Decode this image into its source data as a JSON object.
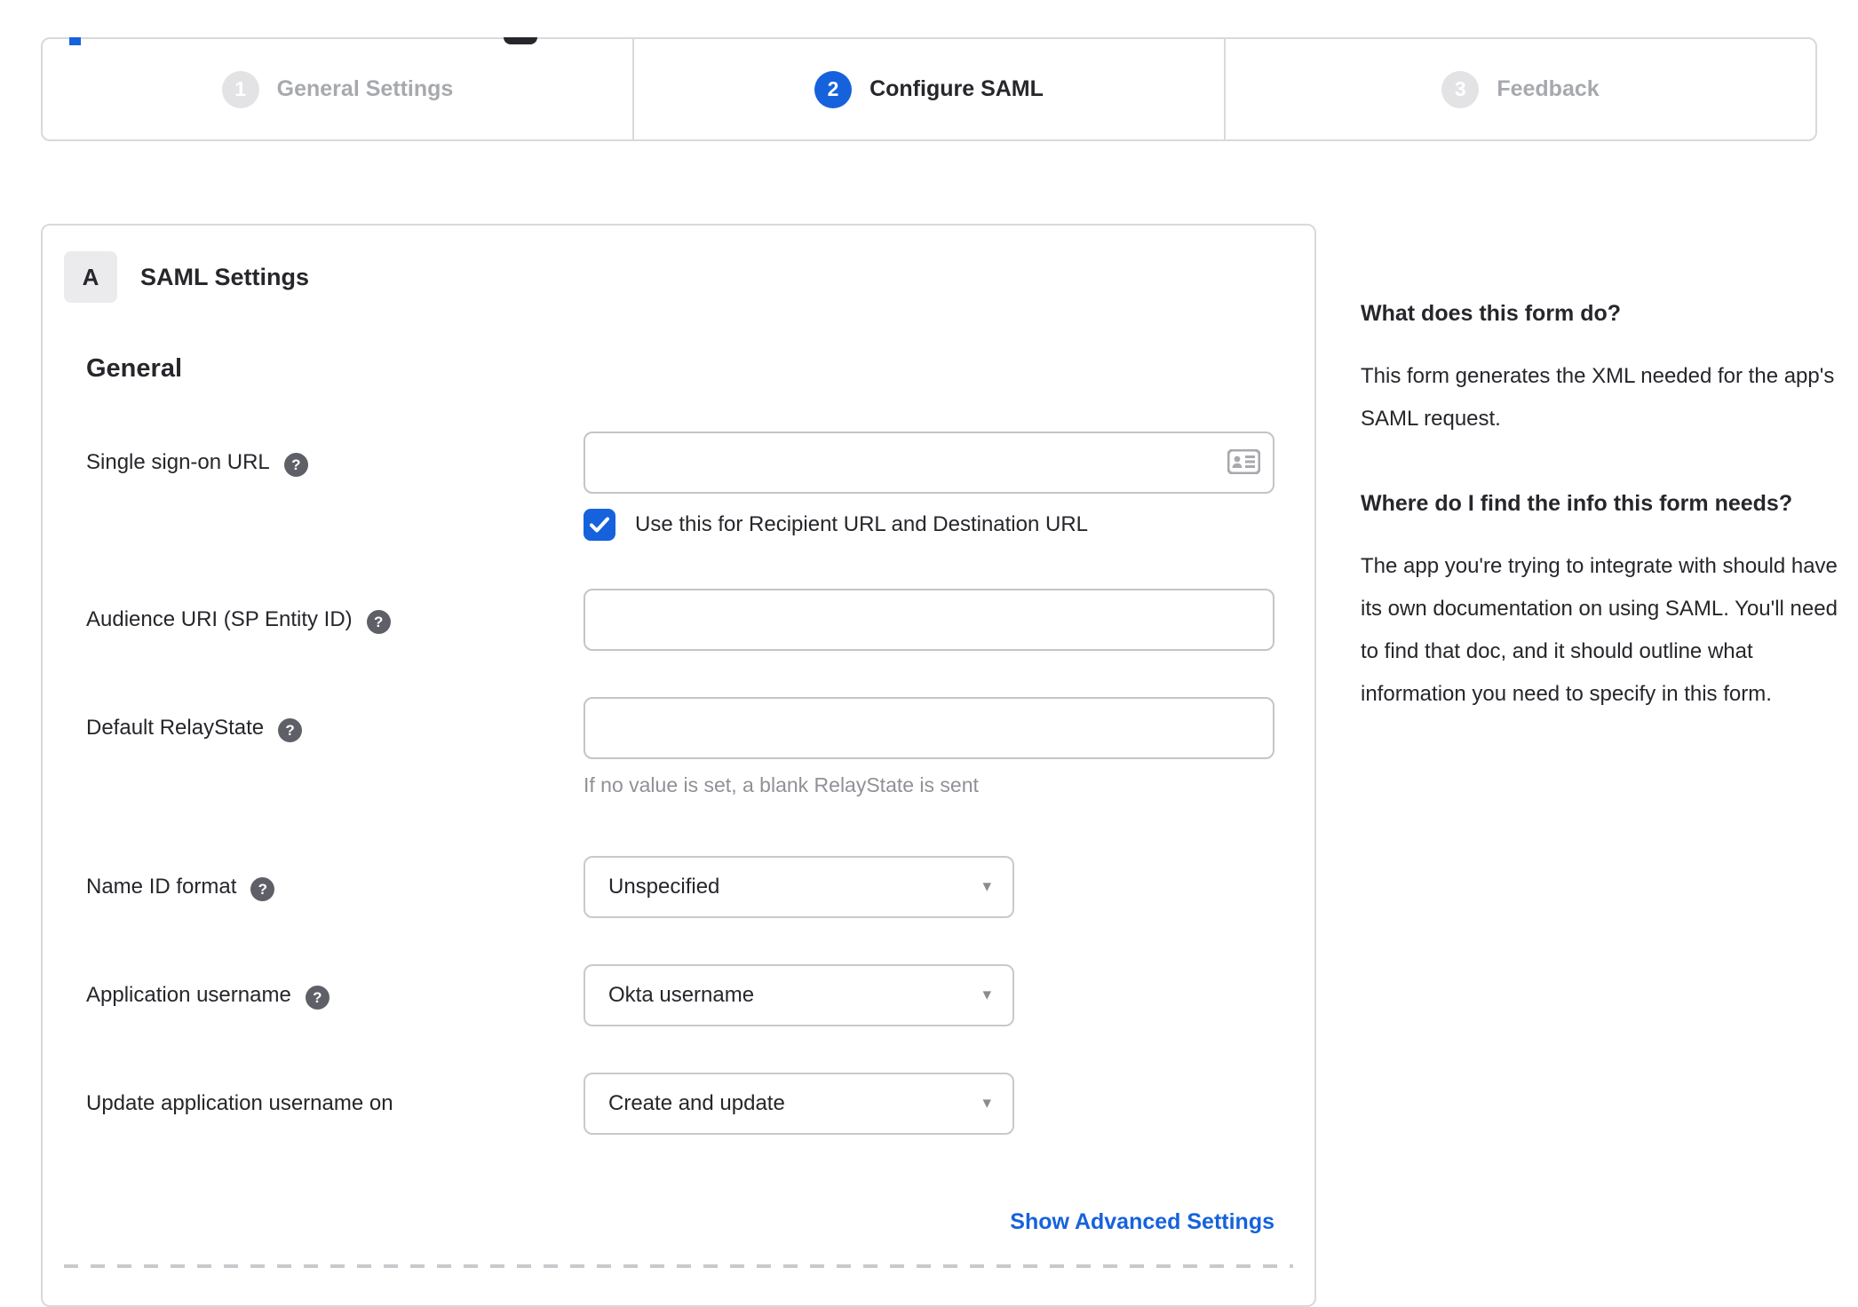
{
  "stepper": {
    "steps": [
      {
        "number": "1",
        "label": "General Settings",
        "state": "inactive"
      },
      {
        "number": "2",
        "label": "Configure SAML",
        "state": "active"
      },
      {
        "number": "3",
        "label": "Feedback",
        "state": "inactive"
      }
    ]
  },
  "panel": {
    "badge": "A",
    "title": "SAML Settings",
    "section_title": "General",
    "fields": {
      "sso_url": {
        "label": "Single sign-on URL",
        "value": ""
      },
      "sso_checkbox": {
        "label": "Use this for Recipient URL and Destination URL",
        "checked": true
      },
      "audience_uri": {
        "label": "Audience URI (SP Entity ID)",
        "value": ""
      },
      "default_relay_state": {
        "label": "Default RelayState",
        "value": "",
        "hint": "If no value is set, a blank RelayState is sent"
      },
      "name_id_format": {
        "label": "Name ID format",
        "value": "Unspecified"
      },
      "application_username": {
        "label": "Application username",
        "value": "Okta username"
      },
      "update_app_username": {
        "label": "Update application username on",
        "value": "Create and update"
      }
    },
    "advanced_link": "Show Advanced Settings"
  },
  "sidebar": {
    "sections": [
      {
        "heading": "What does this form do?",
        "body": "This form generates the XML needed for the app's SAML request."
      },
      {
        "heading": "Where do I find the info this form needs?",
        "body": "The app you're trying to integrate with should have its own documentation on using SAML. You'll need to find that doc, and it should outline what information you need to specify in this form."
      }
    ]
  },
  "icons": {
    "help": "?",
    "caret": "▾"
  },
  "colors": {
    "accent_blue": "#1662dd",
    "inactive_gray": "#a7a9ae",
    "border_gray": "#d9d9dc"
  }
}
